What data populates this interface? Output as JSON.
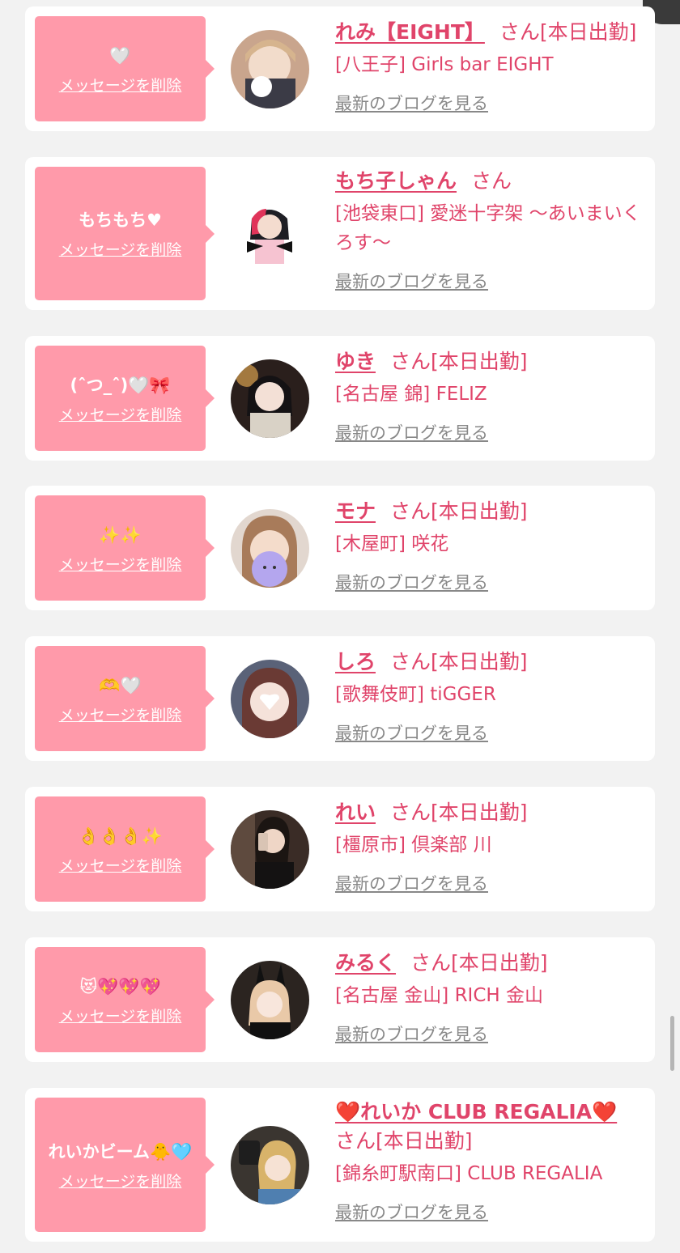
{
  "delete_label": "メッセージを削除",
  "blog_label": "最新のブログを見る",
  "colors": {
    "bubble": "#ff9aaa",
    "name": "#e0446a",
    "blog_link": "#888888",
    "background": "#f2f2f2"
  },
  "items": [
    {
      "message": "🤍",
      "name": "れみ【EIGHT】",
      "suffix": "さん[本日出勤]",
      "shop": "[八王子] Girls bar EIGHT"
    },
    {
      "message": "もちもち♥",
      "name": "もち子しゃん",
      "suffix": "さん",
      "shop": "[池袋東口] 愛迷十字架 〜あいまいくろす〜"
    },
    {
      "message": "(ˆつ_ˆ)🤍🎀",
      "name": "ゆき",
      "suffix": "さん[本日出勤]",
      "shop": "[名古屋 錦] FELIZ"
    },
    {
      "message": "✨✨",
      "name": "モナ",
      "suffix": "さん[本日出勤]",
      "shop": "[木屋町] 咲花"
    },
    {
      "message": "🫶🤍",
      "name": "しろ",
      "suffix": "さん[本日出勤]",
      "shop": "[歌舞伎町] tiGGER"
    },
    {
      "message": "👌👌👌✨",
      "name": "れい",
      "suffix": "さん[本日出勤]",
      "shop": "[橿原市] 倶楽部 川"
    },
    {
      "message": "😻💖💖💖",
      "name": "みるく",
      "suffix": "さん[本日出勤]",
      "shop": "[名古屋 金山] RICH 金山"
    },
    {
      "message": "れいかビーム🐥🩵",
      "name": "❤️れいか CLUB REGALIA❤️",
      "suffix": "さん[本日出勤]",
      "shop": "[錦糸町駅南口] CLUB REGALIA"
    }
  ]
}
